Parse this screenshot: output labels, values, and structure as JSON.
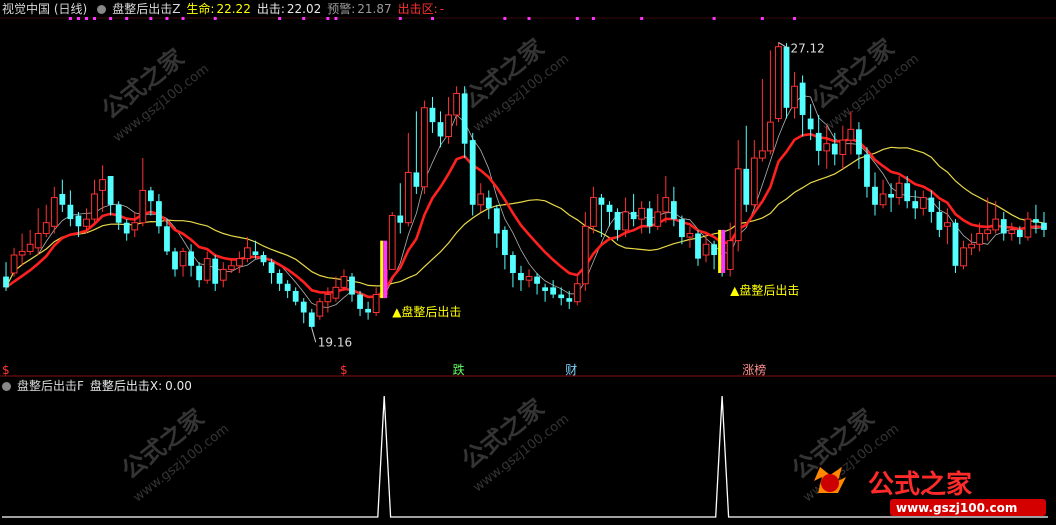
{
  "header": {
    "title": "视觉中国 (日线)",
    "indicator_name": "盘整后出击Z",
    "shengming_label": "生命:",
    "shengming_value": "22.22",
    "chuji_label": "出击:",
    "chuji_value": "22.02",
    "yujing_label": "预警:",
    "yujing_value": "21.87",
    "chujiqu_label": "出击区:",
    "chujiqu_value": "-"
  },
  "sub_header": {
    "indicator_name": "盘整后出击F",
    "x_label": "盘整后出击X:",
    "x_value": "0.00"
  },
  "annotations": {
    "high_label": "27.12",
    "low_label": "19.16",
    "signal_label": "▲盘整后出击"
  },
  "event_markers": [
    "$",
    "$",
    "跌",
    "财",
    "涨榜"
  ],
  "watermarks": [
    "公式之家",
    "www.gszj100.com"
  ],
  "logo": {
    "text": "公式之家",
    "url": "www.gszj100.com"
  },
  "colors": {
    "up": "#ff3232",
    "down": "#54ffff",
    "signal": "#ffff00",
    "ma_red": "#ff2020",
    "ma_yellow": "#e8d848",
    "ma_white": "#d0d0d0",
    "magenta": "#ff33ff"
  },
  "chart_data": {
    "type": "candlestick",
    "ylim": [
      18.5,
      27.8
    ],
    "ohlc": [
      [
        20.6,
        20.3,
        21.0,
        20.2
      ],
      [
        20.7,
        21.2,
        21.4,
        20.6
      ],
      [
        21.2,
        21.3,
        21.8,
        20.9
      ],
      [
        21.3,
        21.5,
        21.9,
        21.2
      ],
      [
        21.4,
        21.8,
        22.5,
        21.2
      ],
      [
        21.8,
        22.1,
        22.6,
        21.7
      ],
      [
        22.0,
        22.8,
        23.1,
        21.8
      ],
      [
        22.9,
        22.6,
        23.3,
        22.4
      ],
      [
        22.6,
        22.2,
        23.0,
        22.0
      ],
      [
        22.3,
        22.0,
        22.4,
        21.7
      ],
      [
        22.0,
        22.2,
        22.5,
        21.8
      ],
      [
        22.2,
        22.9,
        23.3,
        22.1
      ],
      [
        23.0,
        23.3,
        23.7,
        22.4
      ],
      [
        23.4,
        22.6,
        23.4,
        22.3
      ],
      [
        22.6,
        22.1,
        22.7,
        21.9
      ],
      [
        22.1,
        21.8,
        22.2,
        21.6
      ],
      [
        21.9,
        22.1,
        22.4,
        21.7
      ],
      [
        22.1,
        23.0,
        23.9,
        22.0
      ],
      [
        23.0,
        22.7,
        23.1,
        22.3
      ],
      [
        22.7,
        22.0,
        22.9,
        21.8
      ],
      [
        22.0,
        21.3,
        22.2,
        21.2
      ],
      [
        21.3,
        20.8,
        21.4,
        20.6
      ],
      [
        20.9,
        21.3,
        21.4,
        20.6
      ],
      [
        21.3,
        20.9,
        21.5,
        20.6
      ],
      [
        20.9,
        20.5,
        21.0,
        20.3
      ],
      [
        20.5,
        21.1,
        21.3,
        20.4
      ],
      [
        21.1,
        20.4,
        21.2,
        20.2
      ],
      [
        20.5,
        20.8,
        21.0,
        20.3
      ],
      [
        20.8,
        20.9,
        21.1,
        20.7
      ],
      [
        20.9,
        21.1,
        21.3,
        20.7
      ],
      [
        21.1,
        21.4,
        21.7,
        21.0
      ],
      [
        21.3,
        21.2,
        21.6,
        21.1
      ],
      [
        21.2,
        21.0,
        21.3,
        20.9
      ],
      [
        21.0,
        20.7,
        21.1,
        20.4
      ],
      [
        20.7,
        20.4,
        20.8,
        20.2
      ],
      [
        20.4,
        20.2,
        20.5,
        20.0
      ],
      [
        20.2,
        19.9,
        20.3,
        19.8
      ],
      [
        19.9,
        19.6,
        20.0,
        19.3
      ],
      [
        19.6,
        19.2,
        19.7,
        19.16
      ],
      [
        19.5,
        19.9,
        20.0,
        19.4
      ],
      [
        19.9,
        20.1,
        20.3,
        19.6
      ],
      [
        20.0,
        20.3,
        20.6,
        19.9
      ],
      [
        20.3,
        20.6,
        20.8,
        20.2
      ],
      [
        20.6,
        20.1,
        20.7,
        19.9
      ],
      [
        20.1,
        19.7,
        20.2,
        19.5
      ],
      [
        19.7,
        19.6,
        19.9,
        19.4
      ],
      [
        19.6,
        20.1,
        20.3,
        19.5
      ],
      [
        20.1,
        20.8,
        21.0,
        20.0
      ],
      [
        20.8,
        22.3,
        22.4,
        20.8
      ],
      [
        22.3,
        22.1,
        23.2,
        21.8
      ],
      [
        22.1,
        23.5,
        24.6,
        22.0
      ],
      [
        23.5,
        23.1,
        25.2,
        22.9
      ],
      [
        23.1,
        25.3,
        25.5,
        22.9
      ],
      [
        25.3,
        24.9,
        25.6,
        24.6
      ],
      [
        24.9,
        24.5,
        25.2,
        24.2
      ],
      [
        24.5,
        25.1,
        25.6,
        24.3
      ],
      [
        25.1,
        25.7,
        25.9,
        24.8
      ],
      [
        25.7,
        24.3,
        25.9,
        23.9
      ],
      [
        24.4,
        22.6,
        24.6,
        22.3
      ],
      [
        22.6,
        22.9,
        23.2,
        22.4
      ],
      [
        22.8,
        22.5,
        23.0,
        22.2
      ],
      [
        22.5,
        21.8,
        22.6,
        21.4
      ],
      [
        21.9,
        21.2,
        22.0,
        20.8
      ],
      [
        21.2,
        20.7,
        21.3,
        20.3
      ],
      [
        20.7,
        20.5,
        20.9,
        20.2
      ],
      [
        20.5,
        20.6,
        20.8,
        20.3
      ],
      [
        20.6,
        20.4,
        20.7,
        20.1
      ],
      [
        20.3,
        20.2,
        20.4,
        19.9
      ],
      [
        20.3,
        20.1,
        20.5,
        20.0
      ],
      [
        20.1,
        20.0,
        20.3,
        19.8
      ],
      [
        20.0,
        19.9,
        20.2,
        19.7
      ],
      [
        19.9,
        20.4,
        20.6,
        19.8
      ],
      [
        20.4,
        22.0,
        22.4,
        20.2
      ],
      [
        22.0,
        22.8,
        23.1,
        21.8
      ],
      [
        22.8,
        22.6,
        22.9,
        21.7
      ],
      [
        22.6,
        22.4,
        22.7,
        22.0
      ],
      [
        22.4,
        21.9,
        22.5,
        21.6
      ],
      [
        21.9,
        22.4,
        22.8,
        21.7
      ],
      [
        22.4,
        22.2,
        22.9,
        22.0
      ],
      [
        22.2,
        22.5,
        22.7,
        21.8
      ],
      [
        22.5,
        22.0,
        22.7,
        21.8
      ],
      [
        22.0,
        22.4,
        22.9,
        21.9
      ],
      [
        22.4,
        22.8,
        23.4,
        22.1
      ],
      [
        22.7,
        22.2,
        23.1,
        22.0
      ],
      [
        22.2,
        21.7,
        22.3,
        21.5
      ],
      [
        21.7,
        21.8,
        22.0,
        21.4
      ],
      [
        21.8,
        21.1,
        21.9,
        20.9
      ],
      [
        21.2,
        21.5,
        21.8,
        21.0
      ],
      [
        21.5,
        21.2,
        21.6,
        20.8
      ],
      [
        21.2,
        20.8,
        21.3,
        20.6
      ],
      [
        20.8,
        21.6,
        22.1,
        20.6
      ],
      [
        21.6,
        23.6,
        24.4,
        21.3
      ],
      [
        23.6,
        22.6,
        24.8,
        22.4
      ],
      [
        22.6,
        23.9,
        24.4,
        22.5
      ],
      [
        23.9,
        24.1,
        26.1,
        23.8
      ],
      [
        24.1,
        24.9,
        26.9,
        24.0
      ],
      [
        25.0,
        27.0,
        27.12,
        24.9
      ],
      [
        27.0,
        25.3,
        27.1,
        25.0
      ],
      [
        25.3,
        25.9,
        26.3,
        25.0
      ],
      [
        26.0,
        25.1,
        26.2,
        24.5
      ],
      [
        25.0,
        24.7,
        25.4,
        24.4
      ],
      [
        24.6,
        24.1,
        25.1,
        23.7
      ],
      [
        24.1,
        24.3,
        24.8,
        23.6
      ],
      [
        24.3,
        24.0,
        24.6,
        23.7
      ],
      [
        24.0,
        24.4,
        24.8,
        23.6
      ],
      [
        24.4,
        24.7,
        25.2,
        24.0
      ],
      [
        24.7,
        24.0,
        24.9,
        23.6
      ],
      [
        24.0,
        23.1,
        24.2,
        22.8
      ],
      [
        23.1,
        22.6,
        23.5,
        22.3
      ],
      [
        22.6,
        22.9,
        23.3,
        22.5
      ],
      [
        22.9,
        22.8,
        23.2,
        22.4
      ],
      [
        22.8,
        23.2,
        23.4,
        22.6
      ],
      [
        23.2,
        22.7,
        23.4,
        22.5
      ],
      [
        22.7,
        22.5,
        23.0,
        22.2
      ],
      [
        22.5,
        22.8,
        23.0,
        22.3
      ],
      [
        22.8,
        22.4,
        23.0,
        22.1
      ],
      [
        22.4,
        21.9,
        22.7,
        21.7
      ],
      [
        22.0,
        22.1,
        22.5,
        21.5
      ],
      [
        22.1,
        20.9,
        22.2,
        20.7
      ],
      [
        20.9,
        21.4,
        21.6,
        20.8
      ],
      [
        21.4,
        21.5,
        21.8,
        21.2
      ],
      [
        21.5,
        21.8,
        22.1,
        21.3
      ],
      [
        21.8,
        21.9,
        22.8,
        21.6
      ],
      [
        21.9,
        22.2,
        22.7,
        21.8
      ],
      [
        22.2,
        21.8,
        22.4,
        21.6
      ],
      [
        21.8,
        21.9,
        22.1,
        21.6
      ],
      [
        21.9,
        21.7,
        22.0,
        21.5
      ],
      [
        21.7,
        22.2,
        22.4,
        21.6
      ],
      [
        22.2,
        22.1,
        22.6,
        21.8
      ],
      [
        22.1,
        21.9,
        22.4,
        21.7
      ]
    ],
    "signal_bars": [
      47,
      89
    ],
    "events": [
      [
        0,
        "$"
      ],
      [
        42,
        "$"
      ],
      [
        56,
        "跌"
      ],
      [
        70,
        "财"
      ],
      [
        92,
        "涨榜"
      ]
    ],
    "sub_ylim": [
      0,
      1
    ],
    "sub_values_nonzero": [
      [
        47,
        1
      ],
      [
        89,
        1
      ]
    ]
  }
}
